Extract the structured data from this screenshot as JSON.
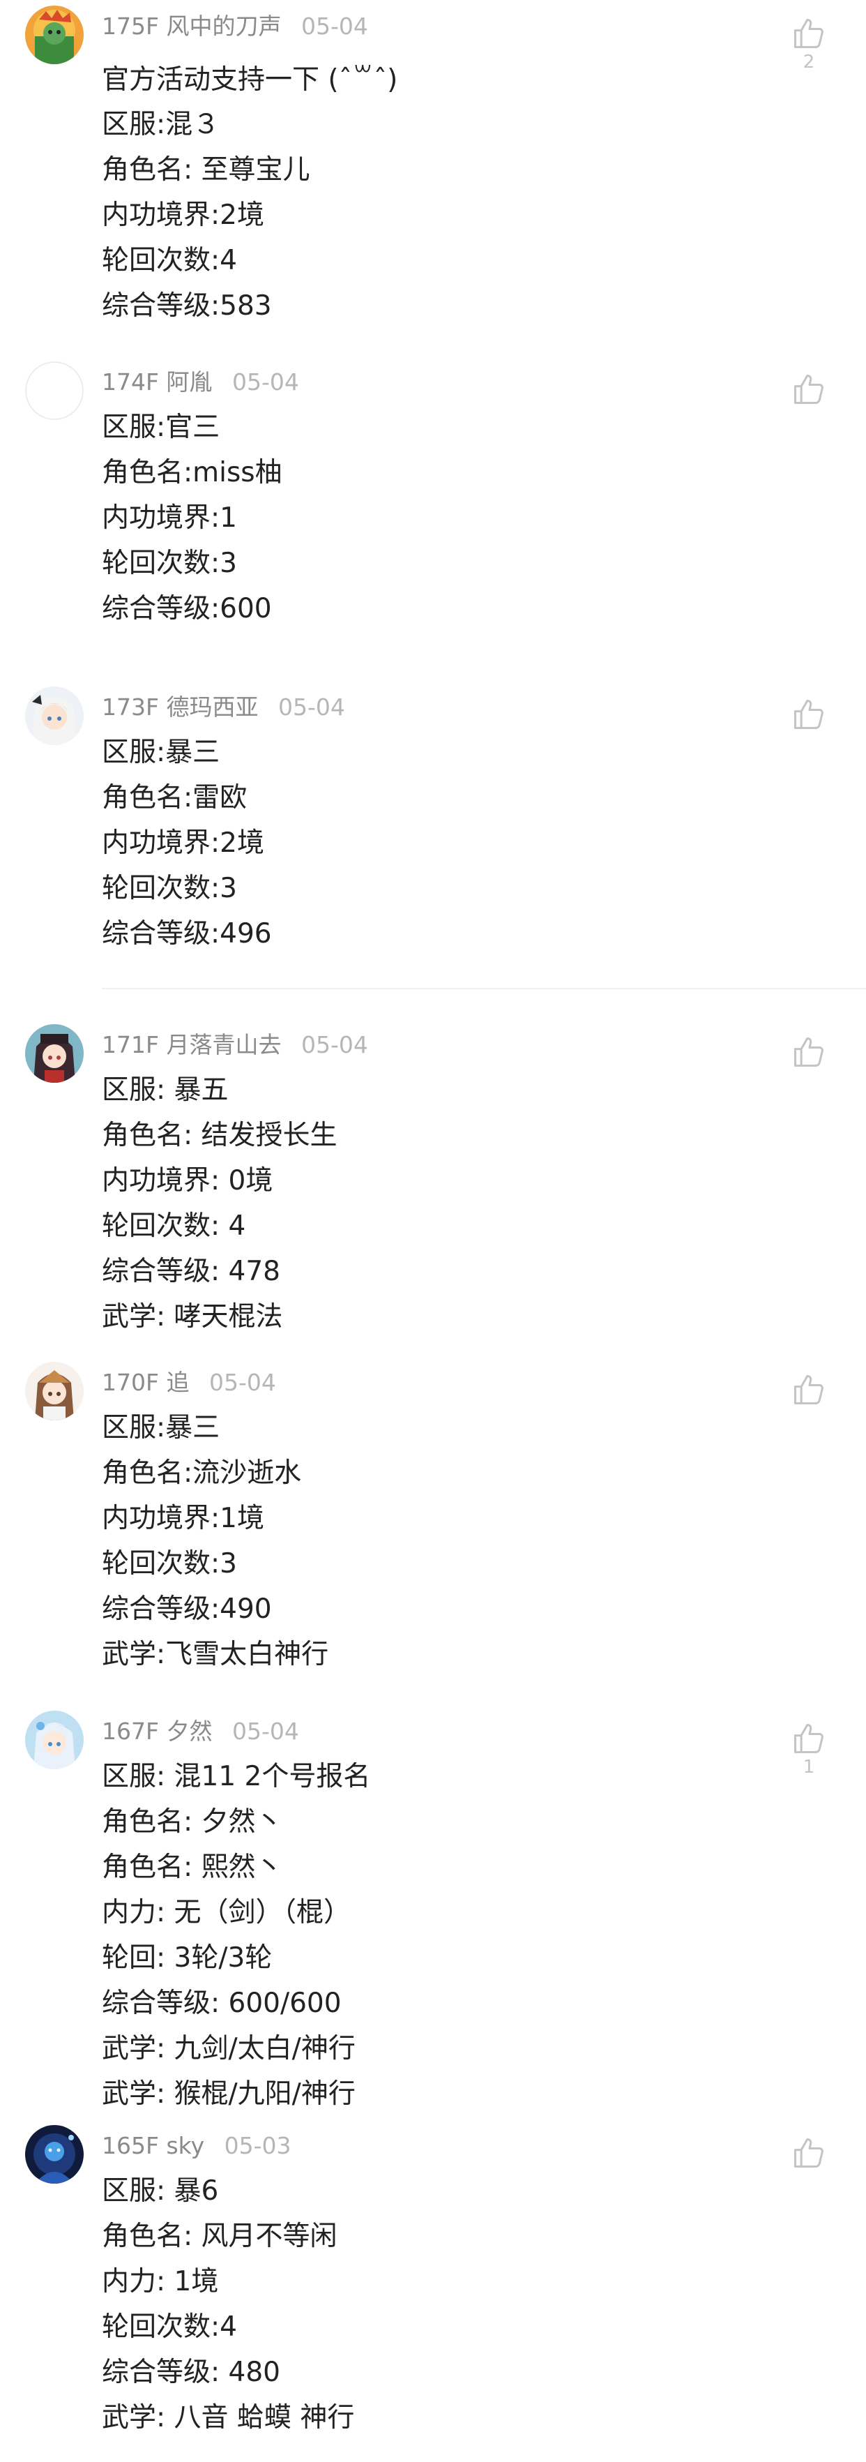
{
  "colors": {
    "meta_text": "#9a9a9a",
    "date_text": "#b6b6b6",
    "body_text": "#222222",
    "like_icon": "#c4c4c4"
  },
  "posts": [
    {
      "floor": "175F",
      "user": "风中的刀声",
      "date": "05-04",
      "like_count": "2",
      "avatar": "cartoon-avatar",
      "lines": [
        "官方活动支持一下 (ˆ꒳ˆ)",
        "区服:混３",
        "角色名:  至尊宝儿",
        "内功境界:2境",
        "轮回次数:4",
        "综合等级:583"
      ]
    },
    {
      "floor": "174F",
      "user": "阿胤",
      "date": "05-04",
      "like_count": "",
      "avatar": "blank-avatar",
      "lines": [
        "区服:官三",
        "角色名:miss柚",
        "内功境界:1",
        "轮回次数:3",
        "综合等级:600"
      ]
    },
    {
      "floor": "173F",
      "user": "德玛西亚",
      "date": "05-04",
      "like_count": "",
      "avatar": "anime-avatar",
      "lines": [
        "区服:暴三",
        "角色名:雷欧",
        "内功境界:2境",
        "轮回次数:3",
        "综合等级:496"
      ]
    },
    {
      "floor": "171F",
      "user": "月落青山去",
      "date": "05-04",
      "like_count": "",
      "avatar": "anime-avatar",
      "lines": [
        "区服:  暴五",
        "角色名:  结发授长生",
        "内功境界:  0境",
        "轮回次数:  4",
        "综合等级:  478",
        "武学:  哮天棍法"
      ]
    },
    {
      "floor": "170F",
      "user": "追",
      "date": "05-04",
      "like_count": "",
      "avatar": "anime-avatar",
      "lines": [
        "区服:暴三",
        "角色名:流沙逝水",
        "内功境界:1境",
        "轮回次数:3",
        "综合等级:490",
        "武学:飞雪太白神行"
      ]
    },
    {
      "floor": "167F",
      "user": "夕然",
      "date": "05-04",
      "like_count": "1",
      "avatar": "anime-avatar",
      "lines": [
        "区服:  混11 2个号报名",
        "角色名:  夕然丶",
        "角色名:  熙然丶",
        "内力:  无（剑）（棍）",
        "轮回:  3轮/3轮",
        "综合等级:  600/600",
        "武学:  九剑/太白/神行",
        "武学:  猴棍/九阳/神行"
      ]
    },
    {
      "floor": "165F",
      "user": "sky",
      "date": "05-03",
      "like_count": "",
      "avatar": "game-avatar",
      "lines": [
        "区服:  暴6",
        "角色名:  风月不等闲",
        "内力:  1境",
        "轮回次数:4",
        "综合等级:  480",
        "武学:  八音 蛤蟆 神行"
      ]
    }
  ]
}
